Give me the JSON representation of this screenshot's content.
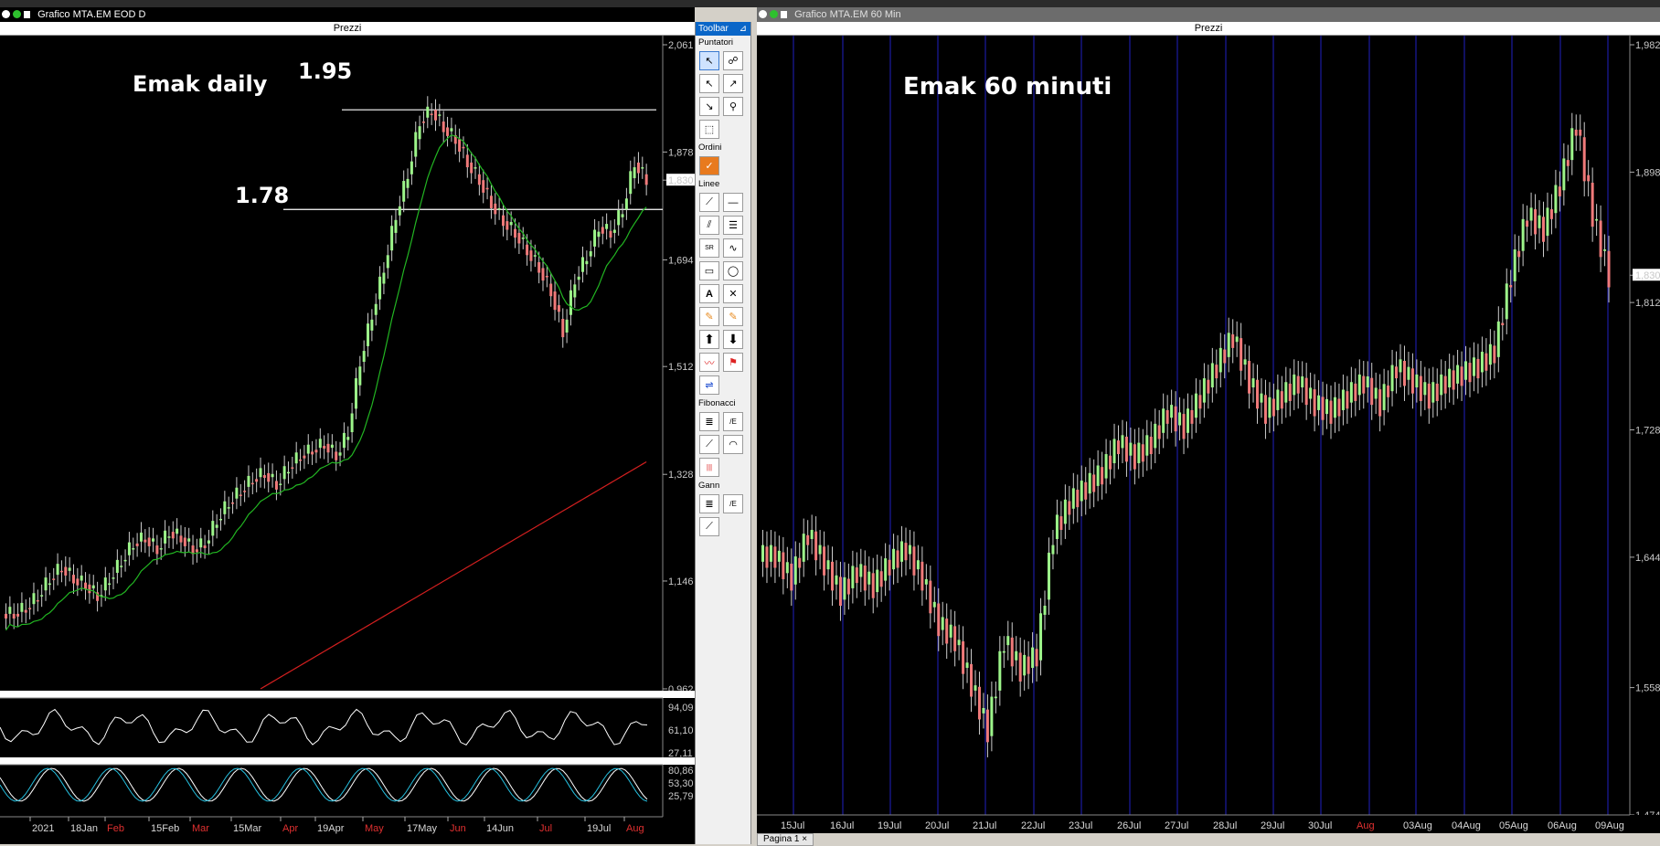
{
  "left_window": {
    "title": "Grafico MTA.EM EOD D",
    "pane_title": "Prezzi",
    "annotation_title": "Emak daily",
    "level_high": "1.95",
    "level_low": "1.78",
    "price_labels": [
      "2,061",
      "1,878",
      "1,830",
      "1,694",
      "1,512",
      "1,328",
      "1,146",
      "0,962"
    ],
    "osc1_labels": [
      "94,09",
      "61,10",
      "27,11"
    ],
    "osc2_labels": [
      "80,86",
      "53,30",
      "25,79"
    ],
    "date_labels": [
      "2021",
      "18Jan",
      "Feb",
      "15Feb",
      "Mar",
      "15Mar",
      "Apr",
      "19Apr",
      "May",
      "17May",
      "Jun",
      "14Jun",
      "Jul",
      "19Jul",
      "Aug"
    ],
    "date_red": [
      false,
      false,
      true,
      false,
      true,
      false,
      true,
      false,
      true,
      false,
      true,
      false,
      true,
      false,
      true
    ]
  },
  "right_window": {
    "title": "Grafico MTA.EM 60 Min",
    "pane_title": "Prezzi",
    "annotation_title": "Emak 60 minuti",
    "price_labels": [
      "1,982",
      "1,898",
      "1,830",
      "1,812",
      "1,728",
      "1,644",
      "1,558",
      "1,474"
    ],
    "date_labels": [
      "15Jul",
      "16Jul",
      "19Jul",
      "20Jul",
      "21Jul",
      "22Jul",
      "23Jul",
      "26Jul",
      "27Jul",
      "28Jul",
      "29Jul",
      "30Jul",
      "Aug",
      "03Aug",
      "04Aug",
      "05Aug",
      "06Aug",
      "09Aug"
    ],
    "date_red": [
      false,
      false,
      false,
      false,
      false,
      false,
      false,
      false,
      false,
      false,
      false,
      false,
      true,
      false,
      false,
      false,
      false,
      false
    ]
  },
  "toolbar": {
    "title": "Toolbar",
    "sections": {
      "pointers": "Puntatori",
      "orders": "Ordini",
      "lines": "Linee",
      "fibonacci": "Fibonacci",
      "gann": "Gann"
    }
  },
  "status": {
    "tab_label": "Pagina 1"
  },
  "colors": {
    "bull": "#9df58a",
    "bear": "#f07a7a",
    "ma_short": "#22b522",
    "ma_long": "#d21f1f",
    "session_line": "#1a1aa0",
    "date_red": "#e03030",
    "date_normal": "#d8d8d8"
  },
  "chart_data": [
    {
      "type": "line",
      "title": "Emak daily",
      "xlabel": "",
      "ylabel": "",
      "ylim": [
        0.962,
        2.061
      ],
      "series": [
        {
          "values": [
            1.09,
            1.1,
            1.12,
            1.15,
            1.17,
            1.15,
            1.14,
            1.12,
            1.15,
            1.18,
            1.21,
            1.22,
            1.2,
            1.23,
            1.22,
            1.2,
            1.21,
            1.25,
            1.28,
            1.3,
            1.32,
            1.33,
            1.31,
            1.34,
            1.36,
            1.37,
            1.38,
            1.36,
            1.4,
            1.52,
            1.6,
            1.68,
            1.77,
            1.84,
            1.93,
            1.95,
            1.92,
            1.9,
            1.86,
            1.83,
            1.79,
            1.76,
            1.74,
            1.71,
            1.68,
            1.64,
            1.57,
            1.66,
            1.7,
            1.75,
            1.74,
            1.78,
            1.86,
            1.83
          ]
        }
      ],
      "levels": [
        1.95,
        1.78
      ]
    },
    {
      "type": "line",
      "title": "Emak 60 minuti",
      "xlabel": "",
      "ylabel": "",
      "ylim": [
        1.474,
        1.982
      ],
      "series": [
        {
          "values": [
            1.645,
            1.63,
            1.66,
            1.64,
            1.62,
            1.635,
            1.625,
            1.64,
            1.65,
            1.63,
            1.6,
            1.59,
            1.56,
            1.53,
            1.59,
            1.57,
            1.58,
            1.66,
            1.68,
            1.69,
            1.7,
            1.72,
            1.71,
            1.72,
            1.74,
            1.73,
            1.75,
            1.77,
            1.79,
            1.76,
            1.74,
            1.75,
            1.76,
            1.745,
            1.74,
            1.75,
            1.76,
            1.745,
            1.77,
            1.76,
            1.75,
            1.76,
            1.765,
            1.77,
            1.78,
            1.83,
            1.87,
            1.86,
            1.89,
            1.93,
            1.87,
            1.83
          ]
        }
      ]
    }
  ]
}
